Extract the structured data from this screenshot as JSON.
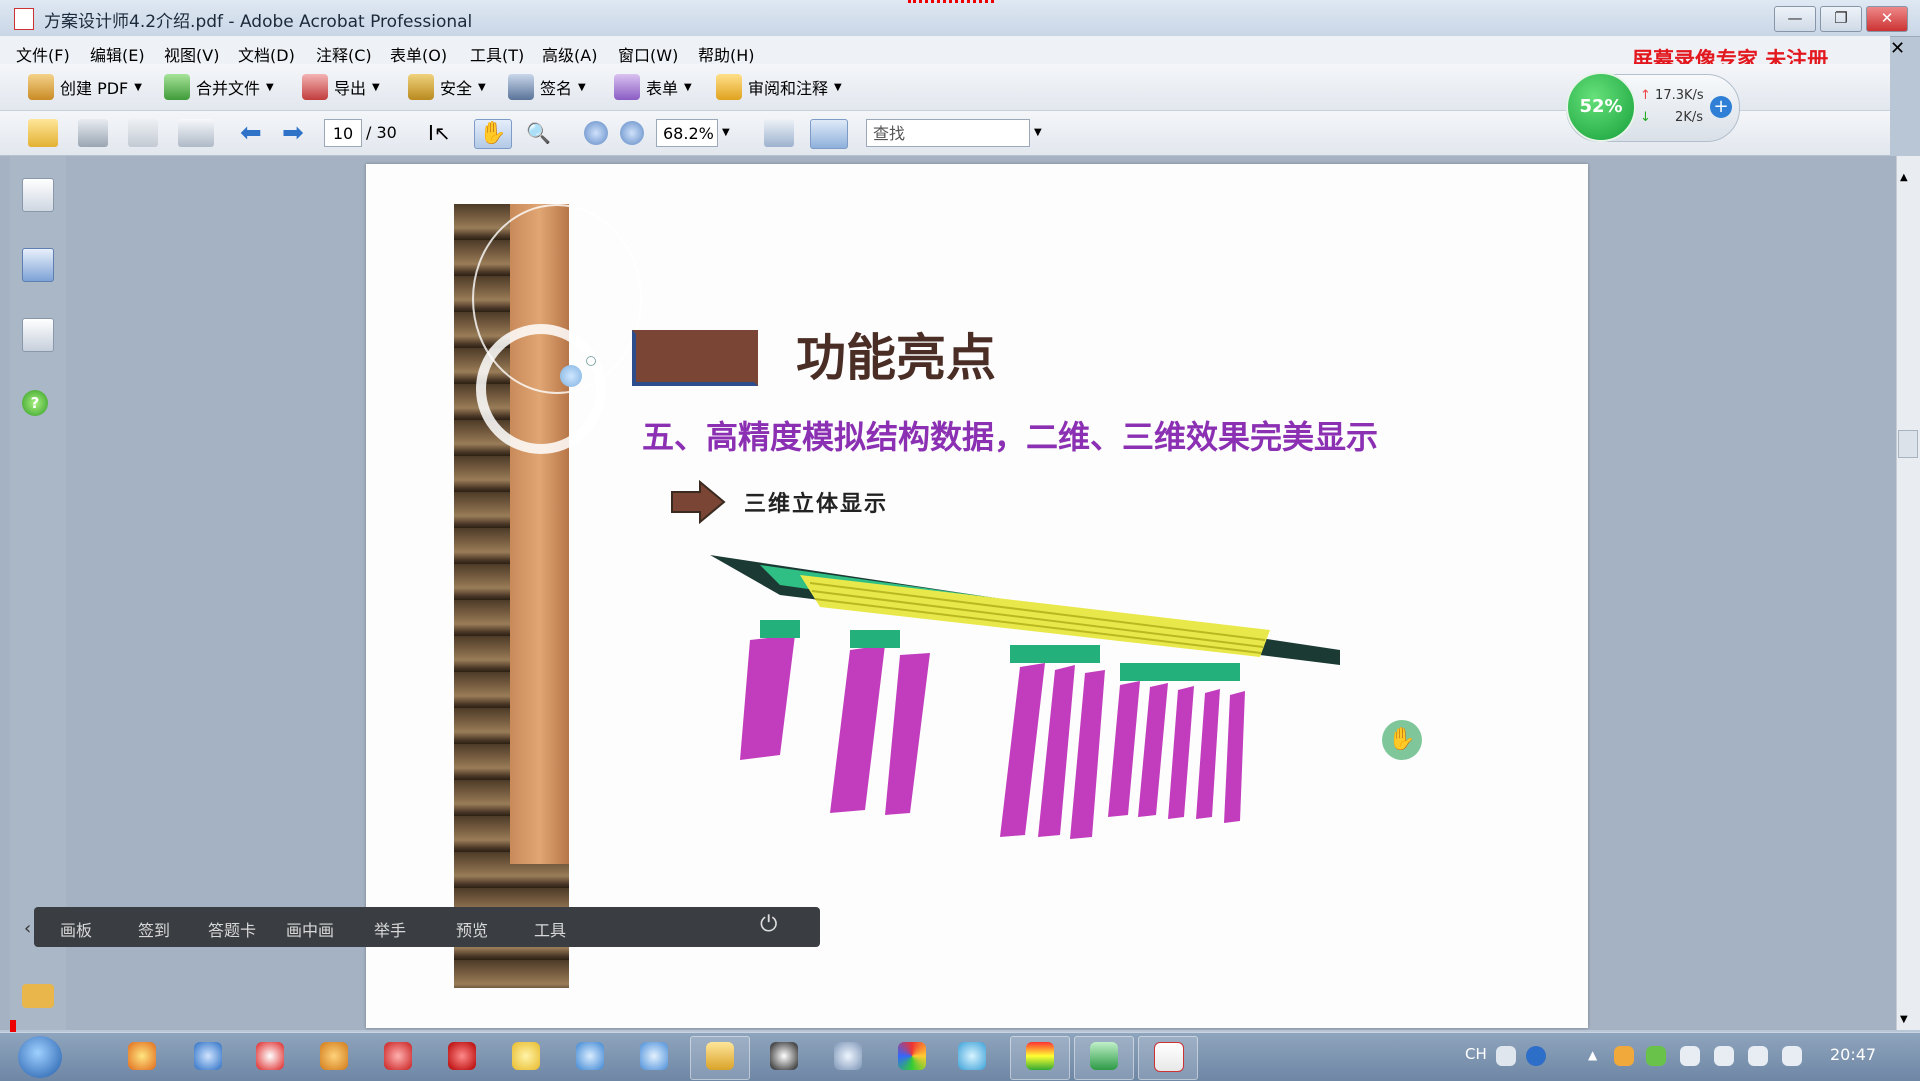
{
  "window": {
    "title": "方案设计师4.2介绍.pdf - Adobe Acrobat Professional"
  },
  "menu": [
    "文件(F)",
    "编辑(E)",
    "视图(V)",
    "文档(D)",
    "注释(C)",
    "表单(O)",
    "工具(T)",
    "高级(A)",
    "窗口(W)",
    "帮助(H)"
  ],
  "watermark": "屏幕录像专家  未注册",
  "toolbar1": {
    "create_pdf": "创建 PDF",
    "merge_files": "合并文件",
    "export": "导出",
    "security": "安全",
    "sign": "签名",
    "forms": "表单",
    "review": "审阅和注释"
  },
  "toolbar2": {
    "page_current": "10",
    "page_total": "/ 30",
    "zoom": "68.2%",
    "search_placeholder": "查找"
  },
  "net": {
    "percent": "52%",
    "upload": "17.3K/s",
    "download": "2K/s"
  },
  "slide": {
    "title": "功能亮点",
    "subtitle": "五、高精度模拟结构数据，二维、三维效果完美显示",
    "bullet": "三维立体显示"
  },
  "floatbar": [
    "画板",
    "签到",
    "答题卡",
    "画中画",
    "举手",
    "预览",
    "工具"
  ],
  "tray": {
    "lang": "CH",
    "time": "20:47"
  },
  "colors": {
    "accent_title": "#8b2fb3",
    "watermark": "#e3181f"
  }
}
